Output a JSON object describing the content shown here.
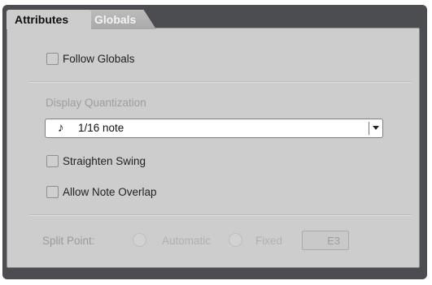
{
  "tabs": [
    {
      "label": "Attributes",
      "active": true
    },
    {
      "label": "Globals",
      "active": false
    }
  ],
  "follow_globals": {
    "label": "Follow Globals",
    "checked": false
  },
  "display_quantization": {
    "label": "Display Quantization",
    "selected_value": "1/16 note",
    "icon": "sixteenth-note-icon"
  },
  "straighten_swing": {
    "label": "Straighten Swing",
    "checked": false
  },
  "allow_note_overlap": {
    "label": "Allow Note Overlap",
    "checked": false
  },
  "split_point": {
    "label": "Split Point:",
    "options": [
      "Automatic",
      "Fixed"
    ],
    "value": "E3",
    "enabled": false
  },
  "colors": {
    "window_bg": "#4b4d51",
    "panel_bg": "#cdcdcd",
    "disabled_text": "#9e9e9e"
  }
}
